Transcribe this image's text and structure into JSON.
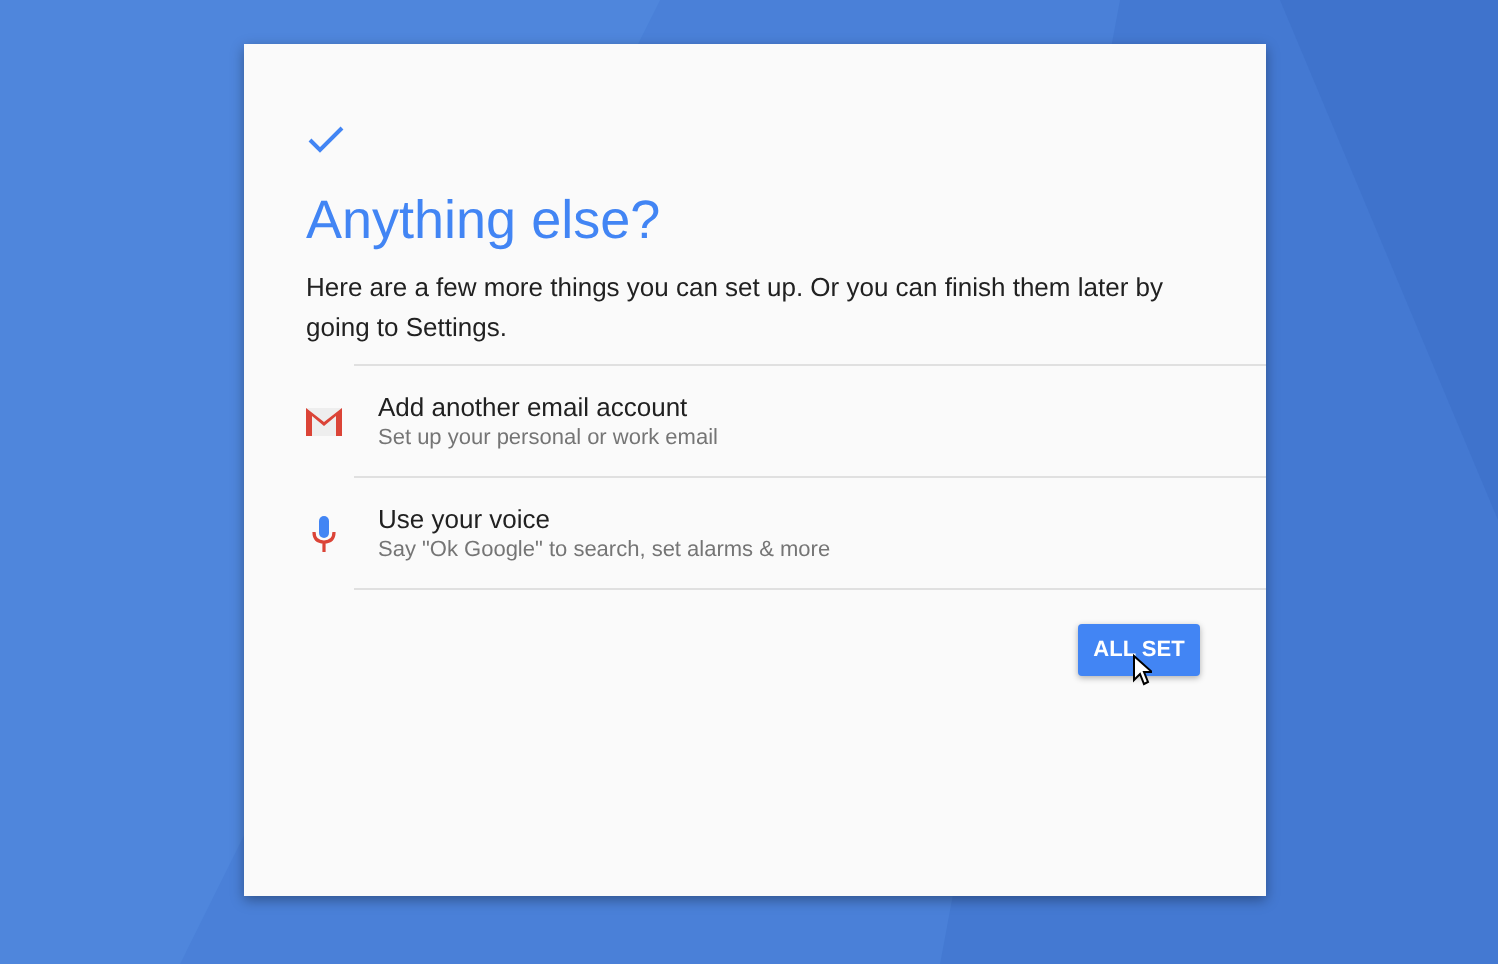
{
  "title": "Anything else?",
  "description": "Here are a few more things you can set up. Or you can finish them later by going to Settings.",
  "options": [
    {
      "kind": "mail",
      "title": "Add another email account",
      "subtitle": "Set up your personal or work email"
    },
    {
      "kind": "mic",
      "title": "Use your voice",
      "subtitle": "Say \"Ok Google\" to search, set alarms & more"
    }
  ],
  "button": "ALL SET"
}
